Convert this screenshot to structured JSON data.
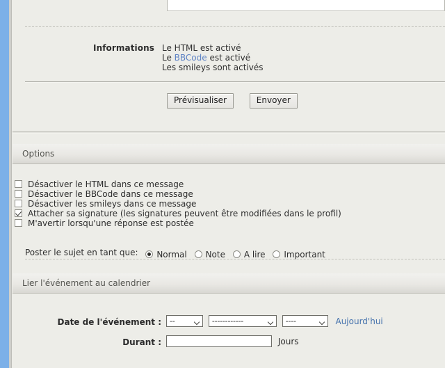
{
  "chrome": {
    "accent_color": "#7cb0e8"
  },
  "compose": {
    "info_label": "Informations",
    "info_lines": [
      {
        "prefix": "Le HTML est activé",
        "link": null,
        "suffix": null
      },
      {
        "prefix": "Le ",
        "link": "BBCode",
        "suffix": " est activé"
      },
      {
        "prefix": "Les smileys sont activés",
        "link": null,
        "suffix": null
      }
    ],
    "preview_button": "Prévisualiser",
    "submit_button": "Envoyer"
  },
  "options": {
    "header": "Options",
    "checkboxes": [
      {
        "label": "Désactiver le HTML dans ce message",
        "checked": false
      },
      {
        "label": "Désactiver le BBCode dans ce message",
        "checked": false
      },
      {
        "label": "Désactiver les smileys dans ce message",
        "checked": false
      },
      {
        "label": "Attacher sa signature (les signatures peuvent être modifiées dans le profil)",
        "checked": true
      },
      {
        "label": "M'avertir lorsqu'une réponse est postée",
        "checked": false
      }
    ],
    "post_as_label": "Poster le sujet en tant que:",
    "post_as_options": [
      {
        "label": "Normal",
        "selected": true
      },
      {
        "label": "Note",
        "selected": false
      },
      {
        "label": "A lire",
        "selected": false
      },
      {
        "label": "Important",
        "selected": false
      }
    ]
  },
  "calendar": {
    "header": "Lier l'événement au calendrier",
    "date_label": "Date de l'événement :",
    "day_value": "--",
    "month_value": "------------",
    "year_value": "----",
    "today_link": "Aujourd'hui",
    "duration_label": "Durant :",
    "duration_value": "",
    "duration_unit": "Jours"
  }
}
